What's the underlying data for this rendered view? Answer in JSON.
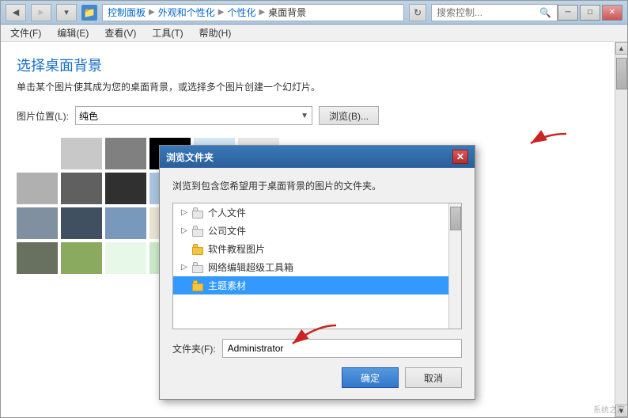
{
  "window": {
    "titlebar": {
      "back_icon": "◀",
      "forward_icon": "▶",
      "down_icon": "▾",
      "breadcrumb": [
        "控制面板",
        "外观和个性化",
        "个性化",
        "桌面背景"
      ],
      "refresh_icon": "↻",
      "search_placeholder": "搜索控制...",
      "search_icon": "🔍",
      "min_label": "─",
      "max_label": "□",
      "close_label": "✕"
    },
    "menubar": [
      {
        "label": "文件(F)",
        "underline": "文"
      },
      {
        "label": "编辑(E)",
        "underline": "编"
      },
      {
        "label": "查看(V)",
        "underline": "查"
      },
      {
        "label": "工具(T)",
        "underline": "工"
      },
      {
        "label": "帮助(H)",
        "underline": "帮"
      }
    ]
  },
  "page": {
    "title": "选择桌面背景",
    "subtitle": "单击某个图片使其成为您的桌面背景，或选择多个图片创建一个幻灯片。",
    "img_pos_label": "图片位置(L):",
    "img_pos_value": "纯色",
    "browse_label": "浏览(B)...",
    "swatches": [
      {
        "color": "#ffffff",
        "selected": false
      },
      {
        "color": "#c8c8c8",
        "selected": false
      },
      {
        "color": "#808080",
        "selected": false
      },
      {
        "color": "#000000",
        "selected": false
      },
      {
        "color": "#d4e8f8",
        "selected": false
      },
      {
        "color": "#e8e8e8",
        "selected": false
      },
      {
        "color": "#b0b0b0",
        "selected": false
      },
      {
        "color": "#606060",
        "selected": false
      },
      {
        "color": "#303030",
        "selected": false
      },
      {
        "color": "#a8c4e0",
        "selected": false
      },
      {
        "color": "#f0f0d0",
        "selected": false
      },
      {
        "color": "#c0c8d8",
        "selected": false
      },
      {
        "color": "#8090a0",
        "selected": false
      },
      {
        "color": "#405060",
        "selected": false
      },
      {
        "color": "#7899bb",
        "selected": false
      },
      {
        "color": "#e8e0d0",
        "selected": false
      },
      {
        "color": "#d8cfc0",
        "selected": false
      },
      {
        "color": "#a89880",
        "selected": false
      },
      {
        "color": "#687060",
        "selected": false
      },
      {
        "color": "#8aaa60",
        "selected": false
      },
      {
        "color": "#e8f8e8",
        "selected": false
      },
      {
        "color": "#c8e8c8",
        "selected": false
      },
      {
        "color": "#80b080",
        "selected": false
      },
      {
        "color": "#3a6a3a",
        "selected": false
      }
    ]
  },
  "dialog": {
    "title": "浏览文件夹",
    "close_icon": "✕",
    "desc": "浏览到包含您希望用于桌面背景的图片的文件夹。",
    "tree_items": [
      {
        "indent": 0,
        "expand": "▷",
        "icon_type": "empty",
        "label": "个人文件"
      },
      {
        "indent": 0,
        "expand": "▷",
        "icon_type": "empty",
        "label": "公司文件"
      },
      {
        "indent": 0,
        "expand": "",
        "icon_type": "folder",
        "label": "软件教程图片"
      },
      {
        "indent": 0,
        "expand": "▷",
        "icon_type": "empty",
        "label": "网络编辑超级工具箱"
      },
      {
        "indent": 0,
        "expand": "",
        "icon_type": "folder",
        "label": "主题素材",
        "selected": true
      }
    ],
    "folder_label": "文件夹(F):",
    "folder_value": "Administrator",
    "ok_label": "确定",
    "cancel_label": "取消"
  },
  "watermark": {
    "text": "系统之家"
  }
}
